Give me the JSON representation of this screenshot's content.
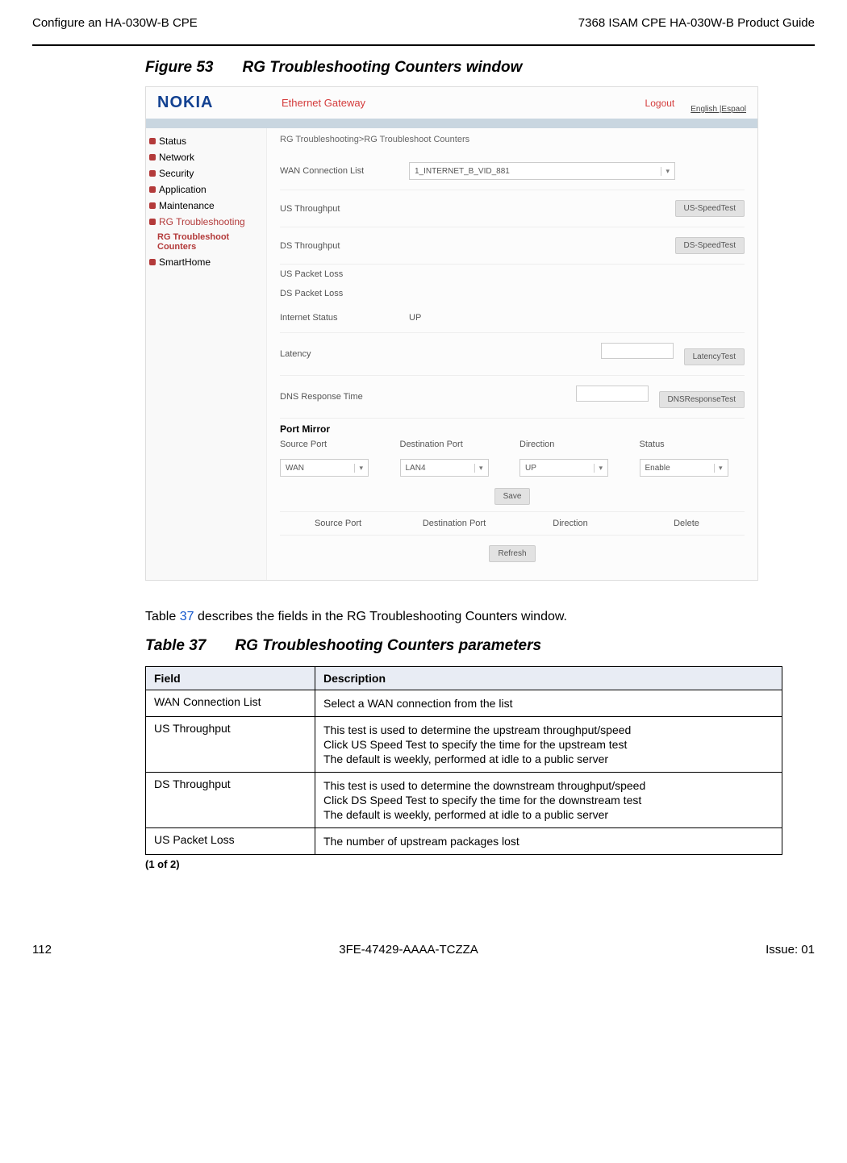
{
  "header": {
    "left": "Configure an HA-030W-B CPE",
    "right": "7368 ISAM CPE HA-030W-B Product Guide"
  },
  "figure": {
    "label": "Figure 53",
    "title": "RG Troubleshooting Counters window"
  },
  "screenshot": {
    "logo": "NOKIA",
    "gateway": "Ethernet Gateway",
    "logout": "Logout",
    "lang": "English |Espaol",
    "sidebar": {
      "items": [
        "Status",
        "Network",
        "Security",
        "Application",
        "Maintenance",
        "RG Troubleshooting"
      ],
      "subitem": "RG Troubleshoot Counters",
      "after": "SmartHome"
    },
    "breadcrumb": "RG Troubleshooting>RG Troubleshoot Counters",
    "wan_label": "WAN Connection List",
    "wan_value": "1_INTERNET_B_VID_881",
    "us_throughput": "US Throughput",
    "us_btn": "US-SpeedTest",
    "ds_throughput": "DS Throughput",
    "ds_btn": "DS-SpeedTest",
    "us_packet": "US Packet Loss",
    "ds_packet": "DS Packet Loss",
    "internet_status_label": "Internet Status",
    "internet_status_value": "UP",
    "latency_label": "Latency",
    "latency_btn": "LatencyTest",
    "dns_label": "DNS Response Time",
    "dns_btn": "DNSResponseTest",
    "port_mirror": "Port Mirror",
    "pm_headers": [
      "Source Port",
      "Destination Port",
      "Direction",
      "Status"
    ],
    "pm_values": [
      "WAN",
      "LAN4",
      "UP",
      "Enable"
    ],
    "save_btn": "Save",
    "table2": [
      "Source Port",
      "Destination Port",
      "Direction",
      "Delete"
    ],
    "refresh_btn": "Refresh"
  },
  "caption": {
    "pre": "Table ",
    "link": "37",
    "post": " describes the fields in the RG Troubleshooting Counters window."
  },
  "table": {
    "label": "Table 37",
    "title": "RG Troubleshooting Counters parameters",
    "headers": [
      "Field",
      "Description"
    ],
    "rows": [
      {
        "field": "WAN Connection List",
        "desc": [
          "Select a WAN connection from the list"
        ]
      },
      {
        "field": "US Throughput",
        "desc": [
          "This test is used to determine the upstream throughput/speed",
          "Click US Speed Test to specify the time for the upstream test",
          "The default is weekly, performed at idle to a public server"
        ]
      },
      {
        "field": "DS Throughput",
        "desc": [
          "This test is used to determine the downstream throughput/speed",
          "Click DS Speed Test to specify the time for the downstream test",
          "The default is weekly, performed at idle to a public server"
        ]
      },
      {
        "field": "US Packet Loss",
        "desc": [
          "The number of upstream packages lost"
        ]
      }
    ],
    "pager": "(1 of 2)"
  },
  "footer": {
    "page": "112",
    "doc": "3FE-47429-AAAA-TCZZA",
    "issue": "Issue: 01"
  }
}
